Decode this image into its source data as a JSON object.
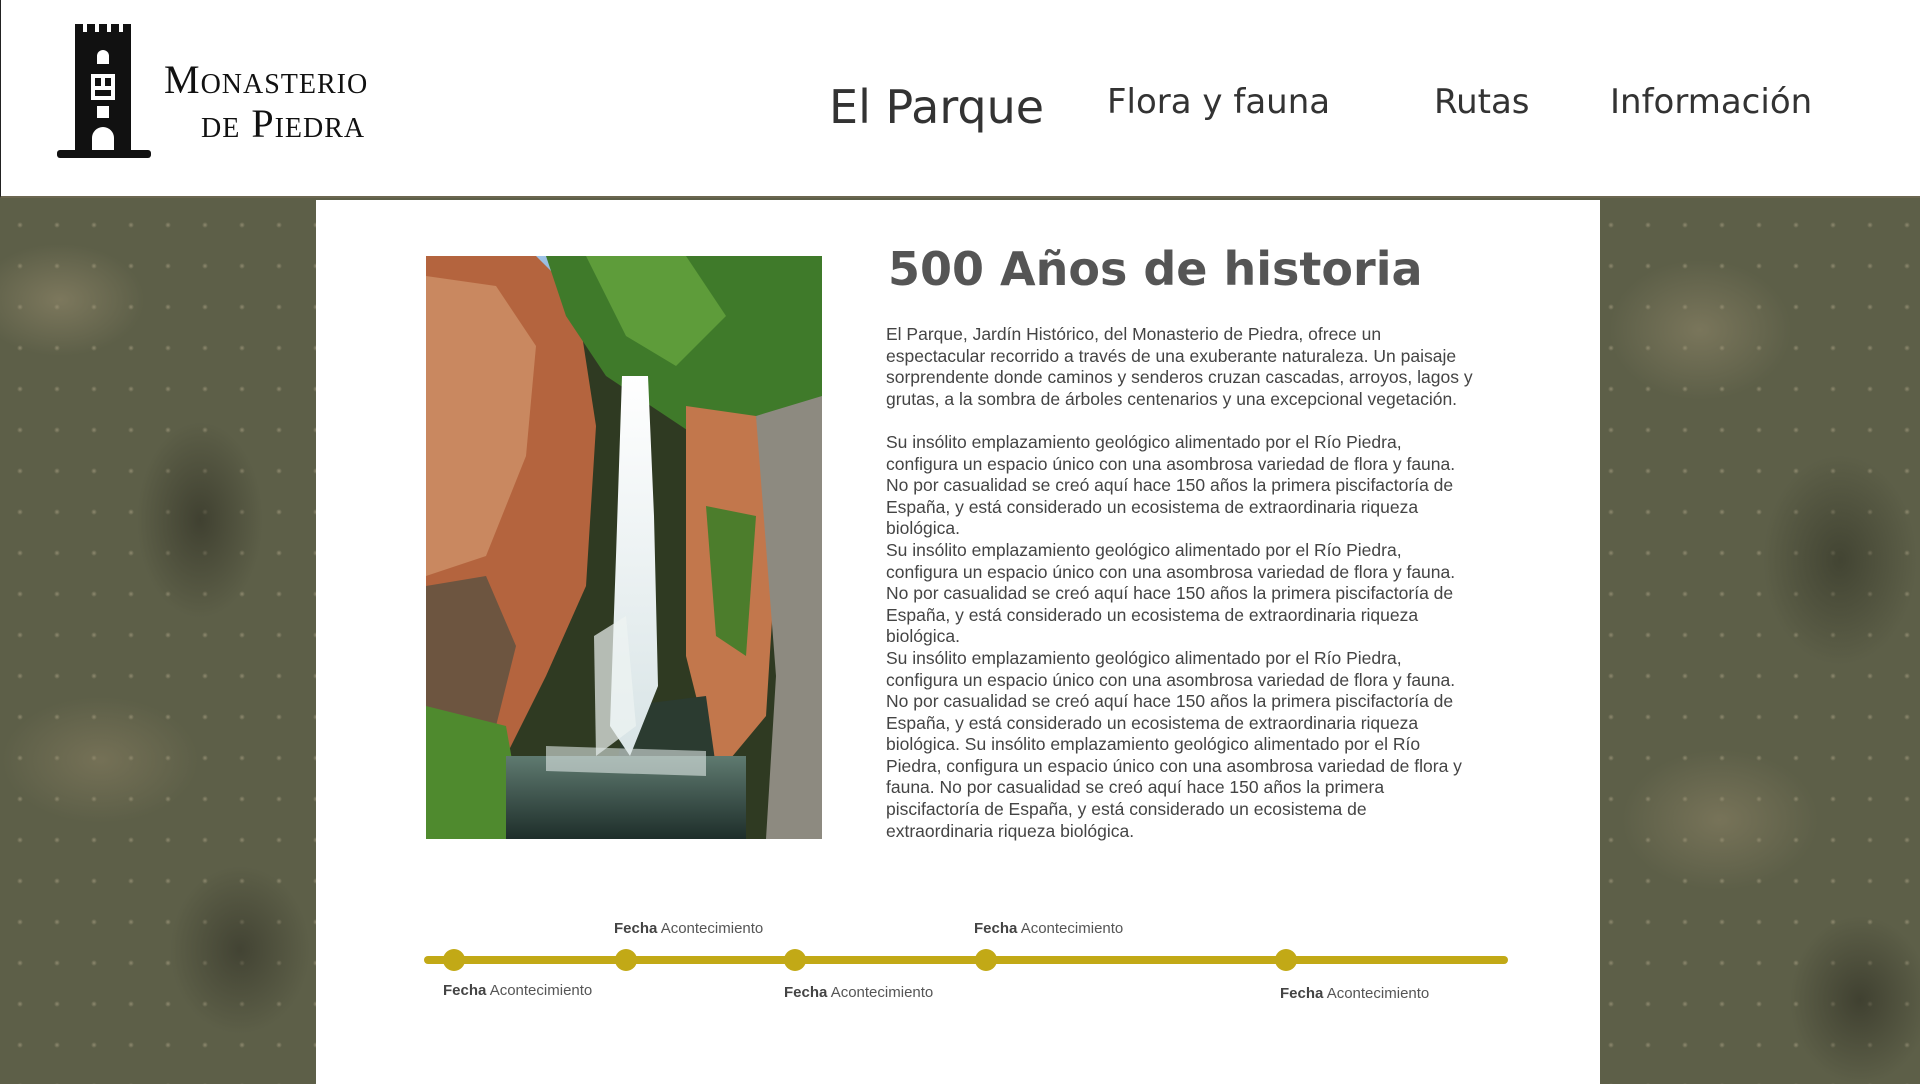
{
  "header": {
    "logo": {
      "line1": "Monasterio",
      "line2": "de Piedra"
    },
    "nav": [
      {
        "label": "El Parque"
      },
      {
        "label": "Flora y fauna"
      },
      {
        "label": "Rutas"
      },
      {
        "label": "Información"
      }
    ]
  },
  "main": {
    "image_icon": "waterfall-photo",
    "title": "500 Años de historia",
    "paragraphs": [
      "El Parque, Jardín Histórico, del Monasterio de Piedra, ofrece un espectacular recorrido a través de una exuberante naturaleza. Un paisaje sorprendente donde caminos y senderos cruzan cascadas, arroyos, lagos y grutas, a la sombra de árboles centenarios y una excepcional vegetación.",
      "Su insólito emplazamiento geológico alimentado por el Río Piedra, configura un espacio único con una asombrosa variedad de flora y fauna. No por casualidad se creó aquí hace 150 años la primera piscifactoría de España, y está considerado un ecosistema de extraordinaria riqueza biológica.",
      "Su insólito emplazamiento geológico alimentado por el Río Piedra, configura un espacio único con una asombrosa variedad de flora y fauna. No por casualidad se creó aquí hace 150 años la primera piscifactoría de España, y está considerado un ecosistema de extraordinaria riqueza biológica.",
      "Su insólito emplazamiento geológico alimentado por el Río Piedra, configura un espacio único con una asombrosa variedad de flora y fauna. No por casualidad se creó aquí hace 150 años la primera piscifactoría de España, y está considerado un ecosistema de extraordinaria riqueza biológica. Su insólito emplazamiento geológico alimentado por el Río Piedra, configura un espacio único con una asombrosa variedad de flora y fauna. No por casualidad se creó aquí hace 150 años la primera piscifactoría de España, y está considerado un ecosistema de extraordinaria riqueza biológica."
    ]
  },
  "timeline": {
    "accent_color": "#c2a916",
    "events": [
      {
        "date": "Fecha",
        "event": "Acontecimiento"
      },
      {
        "date": "Fecha",
        "event": "Acontecimiento"
      },
      {
        "date": "Fecha",
        "event": "Acontecimiento"
      },
      {
        "date": "Fecha",
        "event": "Acontecimiento"
      },
      {
        "date": "Fecha",
        "event": "Acontecimiento"
      }
    ]
  }
}
